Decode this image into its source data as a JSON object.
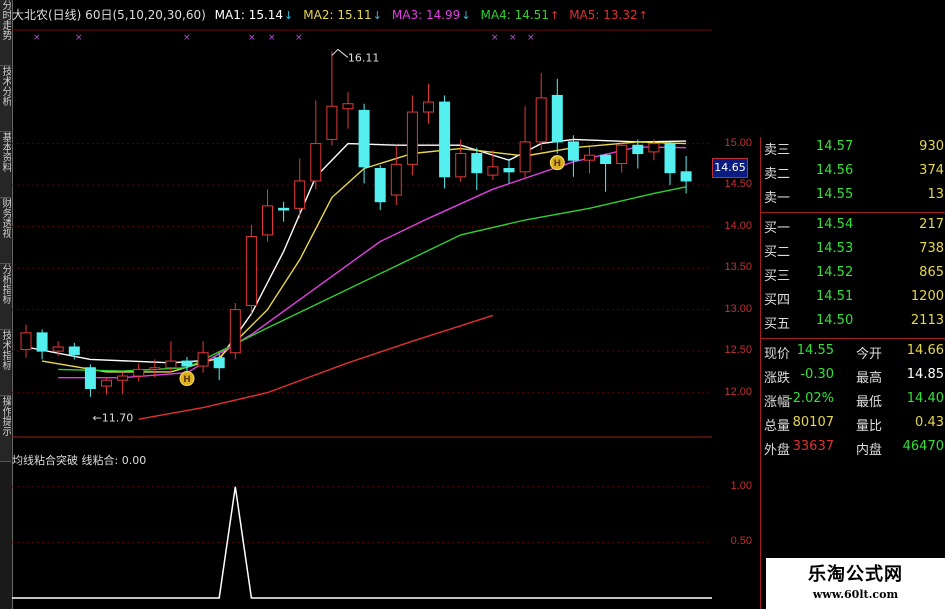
{
  "sidebar": {
    "tabs": [
      "分时走势",
      "技术分析",
      "基本资料",
      "财务透视",
      "分析指标",
      "技术指标",
      "操作提示"
    ]
  },
  "header": {
    "title": "大北农(日线) 60日(5,10,20,30,60)",
    "ma": [
      {
        "label": "MA1: 15.14",
        "arrow": "↓",
        "color": "#ffffff"
      },
      {
        "label": "MA2: 15.11",
        "arrow": "↓",
        "color": "#e8d84a"
      },
      {
        "label": "MA3: 14.99",
        "arrow": "↓",
        "color": "#e040e0"
      },
      {
        "label": "MA4: 14.51",
        "arrow": "↑",
        "color": "#30d030"
      },
      {
        "label": "MA5: 13.32",
        "arrow": "↑",
        "color": "#e03030"
      }
    ]
  },
  "annotations": {
    "high": "16.11",
    "low": "←11.70",
    "tag": "H"
  },
  "indicator": {
    "header": "均线粘合突破 线粘合: 0.00",
    "axis": [
      "1.00",
      "0.50"
    ]
  },
  "price_axis": {
    "ticks": [
      "15.00",
      "14.50",
      "14.00",
      "13.50",
      "13.00",
      "12.50",
      "12.00"
    ],
    "current": "14.65"
  },
  "order_book": {
    "asks": [
      {
        "label": "卖三",
        "price": "14.57",
        "vol": "930"
      },
      {
        "label": "卖二",
        "price": "14.56",
        "vol": "374"
      },
      {
        "label": "卖一",
        "price": "14.55",
        "vol": "13"
      }
    ],
    "bids": [
      {
        "label": "买一",
        "price": "14.54",
        "vol": "217"
      },
      {
        "label": "买二",
        "price": "14.53",
        "vol": "738"
      },
      {
        "label": "买三",
        "price": "14.52",
        "vol": "865"
      },
      {
        "label": "买四",
        "price": "14.51",
        "vol": "1200"
      },
      {
        "label": "买五",
        "price": "14.50",
        "vol": "2113"
      }
    ]
  },
  "stats": [
    {
      "k1": "现价",
      "v1": "14.55",
      "c1": "#33e03a",
      "k2": "今开",
      "v2": "14.66",
      "c2": "#e6d74a"
    },
    {
      "k1": "涨跌",
      "v1": "-0.30",
      "c1": "#33e03a",
      "k2": "最高",
      "v2": "14.85",
      "c2": "#ffffff"
    },
    {
      "k1": "涨幅",
      "v1": "-2.02%",
      "c1": "#33e03a",
      "k2": "最低",
      "v2": "14.40",
      "c2": "#33e03a"
    },
    {
      "k1": "总量",
      "v1": "80107",
      "c1": "#e6d74a",
      "k2": "量比",
      "v2": "0.43",
      "c2": "#e6d74a"
    },
    {
      "k1": "外盘",
      "v1": "33637",
      "c1": "#e03030",
      "k2": "内盘",
      "v2": "46470",
      "c2": "#33e03a"
    }
  ],
  "watermark": {
    "line1": "乐淘公式网",
    "line2": "www.60lt.com"
  },
  "chart_data": {
    "type": "candlestick",
    "ylim": [
      11.55,
      16.32
    ],
    "candles": [
      {
        "o": 12.52,
        "c": 12.72,
        "h": 12.82,
        "l": 12.42
      },
      {
        "o": 12.72,
        "c": 12.5,
        "h": 12.76,
        "l": 12.4
      },
      {
        "o": 12.5,
        "c": 12.55,
        "h": 12.62,
        "l": 12.44
      },
      {
        "o": 12.55,
        "c": 12.46,
        "h": 12.6,
        "l": 12.4
      },
      {
        "o": 12.3,
        "c": 12.05,
        "h": 12.34,
        "l": 11.95
      },
      {
        "o": 12.08,
        "c": 12.15,
        "h": 12.18,
        "l": 11.98
      },
      {
        "o": 12.15,
        "c": 12.2,
        "h": 12.24,
        "l": 11.98
      },
      {
        "o": 12.2,
        "c": 12.28,
        "h": 12.35,
        "l": 12.14
      },
      {
        "o": 12.28,
        "c": 12.3,
        "h": 12.4,
        "l": 12.18
      },
      {
        "o": 12.3,
        "c": 12.38,
        "h": 12.62,
        "l": 12.24
      },
      {
        "o": 12.38,
        "c": 12.32,
        "h": 12.43,
        "l": 12.24
      },
      {
        "o": 12.32,
        "c": 12.48,
        "h": 12.62,
        "l": 12.24
      },
      {
        "o": 12.42,
        "c": 12.3,
        "h": 12.48,
        "l": 12.15
      },
      {
        "o": 12.48,
        "c": 13.0,
        "h": 13.08,
        "l": 12.4
      },
      {
        "o": 13.05,
        "c": 13.88,
        "h": 14.02,
        "l": 12.95
      },
      {
        "o": 13.9,
        "c": 14.25,
        "h": 14.45,
        "l": 13.82
      },
      {
        "o": 14.22,
        "c": 14.2,
        "h": 14.3,
        "l": 14.06
      },
      {
        "o": 14.22,
        "c": 14.55,
        "h": 14.82,
        "l": 14.1
      },
      {
        "o": 14.55,
        "c": 15.0,
        "h": 15.52,
        "l": 14.45
      },
      {
        "o": 15.05,
        "c": 15.45,
        "h": 16.11,
        "l": 14.98
      },
      {
        "o": 15.42,
        "c": 15.48,
        "h": 15.62,
        "l": 15.18
      },
      {
        "o": 15.4,
        "c": 14.72,
        "h": 15.48,
        "l": 14.52
      },
      {
        "o": 14.7,
        "c": 14.3,
        "h": 14.74,
        "l": 14.2
      },
      {
        "o": 14.38,
        "c": 14.75,
        "h": 14.98,
        "l": 14.26
      },
      {
        "o": 14.75,
        "c": 15.38,
        "h": 15.58,
        "l": 14.62
      },
      {
        "o": 15.38,
        "c": 15.5,
        "h": 15.72,
        "l": 15.24
      },
      {
        "o": 15.5,
        "c": 14.6,
        "h": 15.58,
        "l": 14.46
      },
      {
        "o": 14.6,
        "c": 14.88,
        "h": 15.05,
        "l": 14.54
      },
      {
        "o": 14.88,
        "c": 14.65,
        "h": 14.95,
        "l": 14.44
      },
      {
        "o": 14.62,
        "c": 14.72,
        "h": 14.92,
        "l": 14.56
      },
      {
        "o": 14.7,
        "c": 14.66,
        "h": 14.82,
        "l": 14.52
      },
      {
        "o": 14.66,
        "c": 15.02,
        "h": 15.45,
        "l": 14.58
      },
      {
        "o": 15.02,
        "c": 15.55,
        "h": 15.85,
        "l": 14.92
      },
      {
        "o": 15.58,
        "c": 15.02,
        "h": 15.78,
        "l": 14.88
      },
      {
        "o": 15.02,
        "c": 14.8,
        "h": 15.1,
        "l": 14.6
      },
      {
        "o": 14.8,
        "c": 14.86,
        "h": 14.96,
        "l": 14.64
      },
      {
        "o": 14.86,
        "c": 14.76,
        "h": 14.88,
        "l": 14.42
      },
      {
        "o": 14.76,
        "c": 14.98,
        "h": 15.02,
        "l": 14.65
      },
      {
        "o": 14.98,
        "c": 14.88,
        "h": 15.05,
        "l": 14.7
      },
      {
        "o": 14.9,
        "c": 15.0,
        "h": 15.05,
        "l": 14.8
      },
      {
        "o": 15.0,
        "c": 14.65,
        "h": 15.02,
        "l": 14.5
      },
      {
        "o": 14.66,
        "c": 14.55,
        "h": 14.85,
        "l": 14.4
      }
    ],
    "ma": [
      {
        "name": "MA1",
        "color": "#ffffff",
        "points": [
          [
            0,
            12.55
          ],
          [
            4,
            12.4
          ],
          [
            9,
            12.36
          ],
          [
            12,
            12.4
          ],
          [
            14,
            12.95
          ],
          [
            16,
            13.7
          ],
          [
            18,
            14.6
          ],
          [
            20,
            15.0
          ],
          [
            23,
            14.98
          ],
          [
            27,
            14.98
          ],
          [
            30,
            14.8
          ],
          [
            32,
            15.0
          ],
          [
            34,
            15.05
          ],
          [
            38,
            15.02
          ],
          [
            41,
            15.03
          ]
        ]
      },
      {
        "name": "MA2",
        "color": "#e8d84a",
        "points": [
          [
            1,
            12.38
          ],
          [
            5,
            12.25
          ],
          [
            9,
            12.25
          ],
          [
            12,
            12.42
          ],
          [
            15,
            13.0
          ],
          [
            17,
            13.6
          ],
          [
            19,
            14.35
          ],
          [
            21,
            14.7
          ],
          [
            24,
            14.88
          ],
          [
            27,
            14.94
          ],
          [
            31,
            14.85
          ],
          [
            34,
            14.95
          ],
          [
            38,
            15.02
          ],
          [
            41,
            15.0
          ]
        ]
      },
      {
        "name": "MA3",
        "color": "#e040e0",
        "points": [
          [
            2,
            12.18
          ],
          [
            6,
            12.18
          ],
          [
            10,
            12.24
          ],
          [
            14,
            12.7
          ],
          [
            22,
            13.82
          ],
          [
            25,
            14.1
          ],
          [
            29,
            14.45
          ],
          [
            34,
            14.78
          ],
          [
            38,
            14.96
          ],
          [
            41,
            14.95
          ]
        ]
      },
      {
        "name": "MA4",
        "color": "#30d030",
        "points": [
          [
            2,
            12.28
          ],
          [
            6,
            12.26
          ],
          [
            10,
            12.3
          ],
          [
            15,
            12.78
          ],
          [
            27,
            13.9
          ],
          [
            31,
            14.08
          ],
          [
            35,
            14.22
          ],
          [
            39,
            14.4
          ],
          [
            41,
            14.48
          ]
        ]
      },
      {
        "name": "MA5",
        "color": "#e03030",
        "points": [
          [
            7,
            11.68
          ],
          [
            11,
            11.82
          ],
          [
            15,
            12.0
          ],
          [
            20,
            12.36
          ],
          [
            24,
            12.62
          ],
          [
            29,
            12.93
          ]
        ]
      }
    ],
    "markers": [
      {
        "index": 10,
        "price": 12.17
      },
      {
        "index": 33,
        "price": 14.77
      }
    ],
    "indicator": {
      "ylim": [
        0,
        1.15
      ],
      "signal_index": 13,
      "signal_value": 1.0
    }
  }
}
